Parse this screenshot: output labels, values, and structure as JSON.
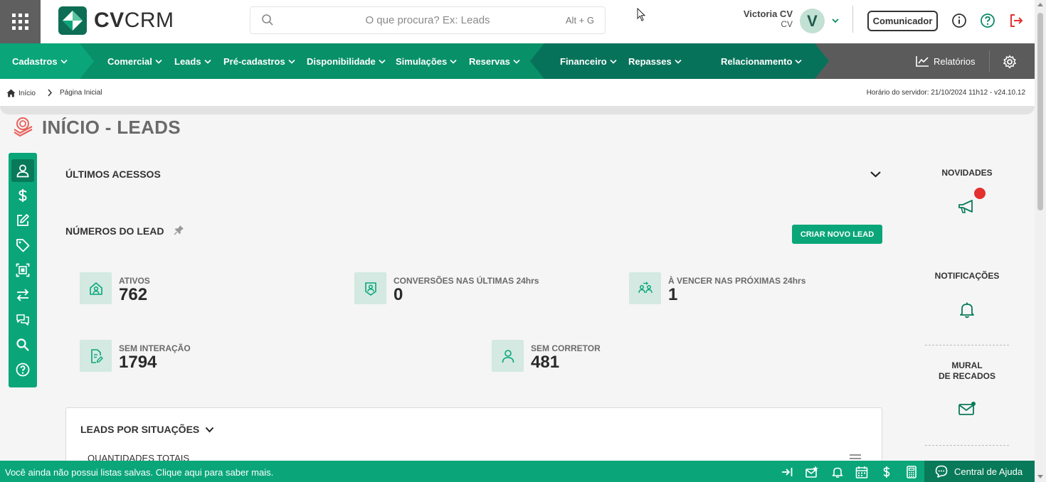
{
  "header": {
    "logo_bold": "CV",
    "logo_rest": "CRM",
    "search_placeholder": "O que procura? Ex: Leads",
    "search_shortcut": "Alt + G",
    "user_name": "Victoria CV",
    "user_sub": "CV",
    "avatar_letter": "V",
    "comunicador_label": "Comunicador",
    "icons": [
      "apps-grid-icon",
      "search-icon",
      "chevron-down-icon",
      "info-icon",
      "help-icon",
      "logout-icon"
    ]
  },
  "nav": {
    "items": [
      {
        "label": "Cadastros"
      },
      {
        "label": "Comercial"
      },
      {
        "label": "Leads"
      },
      {
        "label": "Pré-cadastros"
      },
      {
        "label": "Disponibilidade"
      },
      {
        "label": "Simulações"
      },
      {
        "label": "Reservas"
      },
      {
        "label": "Financeiro"
      },
      {
        "label": "Repasses"
      },
      {
        "label": "Relacionamento"
      }
    ],
    "reports_label": "Relatórios",
    "colors": {
      "seg1": "#0aa67a",
      "seg2": "#089068",
      "seg3": "#07725a",
      "seg4": "#5b5b5b"
    }
  },
  "breadcrumb": {
    "home": "Início",
    "current": "Página Inicial",
    "server_time": "Horário do servidor: 21/10/2024 11h12 - v24.10.12"
  },
  "page": {
    "title": "INÍCIO - LEADS"
  },
  "sidebar": {
    "tools": [
      "user-icon",
      "dollar-icon",
      "edit-icon",
      "tag-icon",
      "scanner-icon",
      "transfer-icon",
      "chat-icon",
      "search-icon",
      "help-icon"
    ]
  },
  "main": {
    "ultimos_acessos": "ÚLTIMOS ACESSOS",
    "numeros_title": "NÚMEROS DO LEAD",
    "criar_label": "CRIAR NOVO LEAD",
    "stats": [
      {
        "label": "ATIVOS",
        "value": "762"
      },
      {
        "label": "CONVERSÕES NAS ÚLTIMAS 24hrs",
        "value": "0"
      },
      {
        "label": "À VENCER NAS PRÓXIMAS 24hrs",
        "value": "1"
      },
      {
        "label": "SEM INTERAÇÃO",
        "value": "1794"
      },
      {
        "label": "SEM CORRETOR",
        "value": "481"
      }
    ],
    "situacoes_title": "LEADS POR SITUAÇÕES",
    "quantidades_title": "QUANTIDADES TOTAIS"
  },
  "right_panel": {
    "novidades": "NOVIDADES",
    "notificacoes": "NOTIFICAÇÕES",
    "mural_line1": "MURAL",
    "mural_line2": "DE RECADOS"
  },
  "bottom": {
    "message": "Você ainda não possui listas salvas. Clique aqui para saber mais.",
    "help_label": "Central de Ajuda",
    "icons": [
      "collapse-right-icon",
      "mail-star-icon",
      "bell-icon",
      "calendar-icon",
      "dollar-icon",
      "calculator-icon",
      "chat-help-icon"
    ]
  },
  "colors": {
    "accent": "#0aa67a",
    "accent_dark": "#087a59",
    "alert": "#e53030"
  }
}
